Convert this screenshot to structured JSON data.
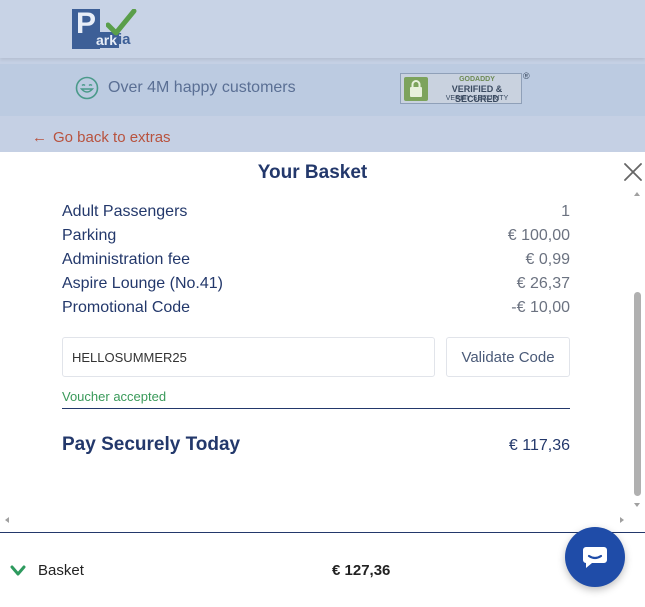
{
  "header": {
    "logo_p": "P",
    "logo_ark": "ark",
    "logo_via": "ia",
    "happy_customers": "Over 4M happy customers",
    "seal_line1": "GODADDY",
    "seal_line2": "VERIFIED & SECURED",
    "seal_line3": "VERIFY SECURITY",
    "seal_registered": "®"
  },
  "nav": {
    "back_link_arrow": "←",
    "back_link": "Go back to extras"
  },
  "basket": {
    "title": "Your Basket",
    "close_icon": "close-icon",
    "items": [
      {
        "label": "Adult Passengers",
        "value": "1"
      },
      {
        "label": "Parking",
        "value": "€ 100,00"
      },
      {
        "label": "Administration fee",
        "value": "€ 0,99"
      },
      {
        "label": "Aspire Lounge (No.41)",
        "value": "€ 26,37"
      },
      {
        "label": "Promotional Code",
        "value": "-€ 10,00"
      }
    ],
    "promo_code_value": "HELLOSUMMER25",
    "validate_button": "Validate Code",
    "voucher_message": "Voucher accepted",
    "pay_label": "Pay Securely Today",
    "pay_value": "€ 117,36"
  },
  "footer": {
    "basket_label": "Basket",
    "basket_total": "€ 127,36"
  },
  "colors": {
    "primary_navy": "#23386b",
    "back_link": "#b8523e",
    "success_green": "#3a9a5a",
    "chat_blue": "#1f4ca8"
  }
}
